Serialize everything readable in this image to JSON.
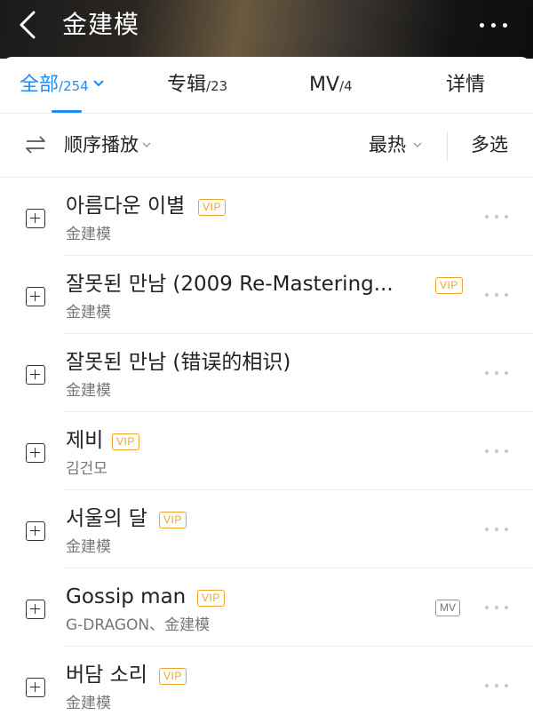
{
  "header": {
    "title": "金建模",
    "back_icon": "chevron-left-icon",
    "more_icon": "more-horizontal-icon"
  },
  "tabs": [
    {
      "label": "全部",
      "count": "/254",
      "active": true
    },
    {
      "label": "专辑",
      "count": "/23",
      "active": false
    },
    {
      "label": "MV",
      "count": "/4",
      "active": false
    },
    {
      "label": "详情",
      "count": "",
      "active": false
    }
  ],
  "toolbar": {
    "play_order_label": "顺序播放",
    "sort_label": "最热",
    "multi_select_label": "多选"
  },
  "songs": [
    {
      "title": "아름다운 이별",
      "artist": "金建模",
      "vip": "VIP",
      "mv": ""
    },
    {
      "title": "잘못된 만남 (2009 Re-Mastering...",
      "artist": "金建模",
      "vip": "VIP",
      "mv": ""
    },
    {
      "title": "잘못된 만남 (错误的相识)",
      "artist": "金建模",
      "vip": "",
      "mv": ""
    },
    {
      "title": "제비",
      "artist": "김건모",
      "vip": "VIP",
      "mv": ""
    },
    {
      "title": "서울의 달",
      "artist": "金建模",
      "vip": "VIP",
      "mv": ""
    },
    {
      "title": "Gossip man",
      "artist": "G-DRAGON、金建模",
      "vip": "VIP",
      "mv": "MV"
    },
    {
      "title": "버담 소리",
      "artist": "金建模",
      "vip": "VIP",
      "mv": ""
    }
  ],
  "colors": {
    "accent": "#1e8cf0",
    "vip": "#f0a32c"
  }
}
